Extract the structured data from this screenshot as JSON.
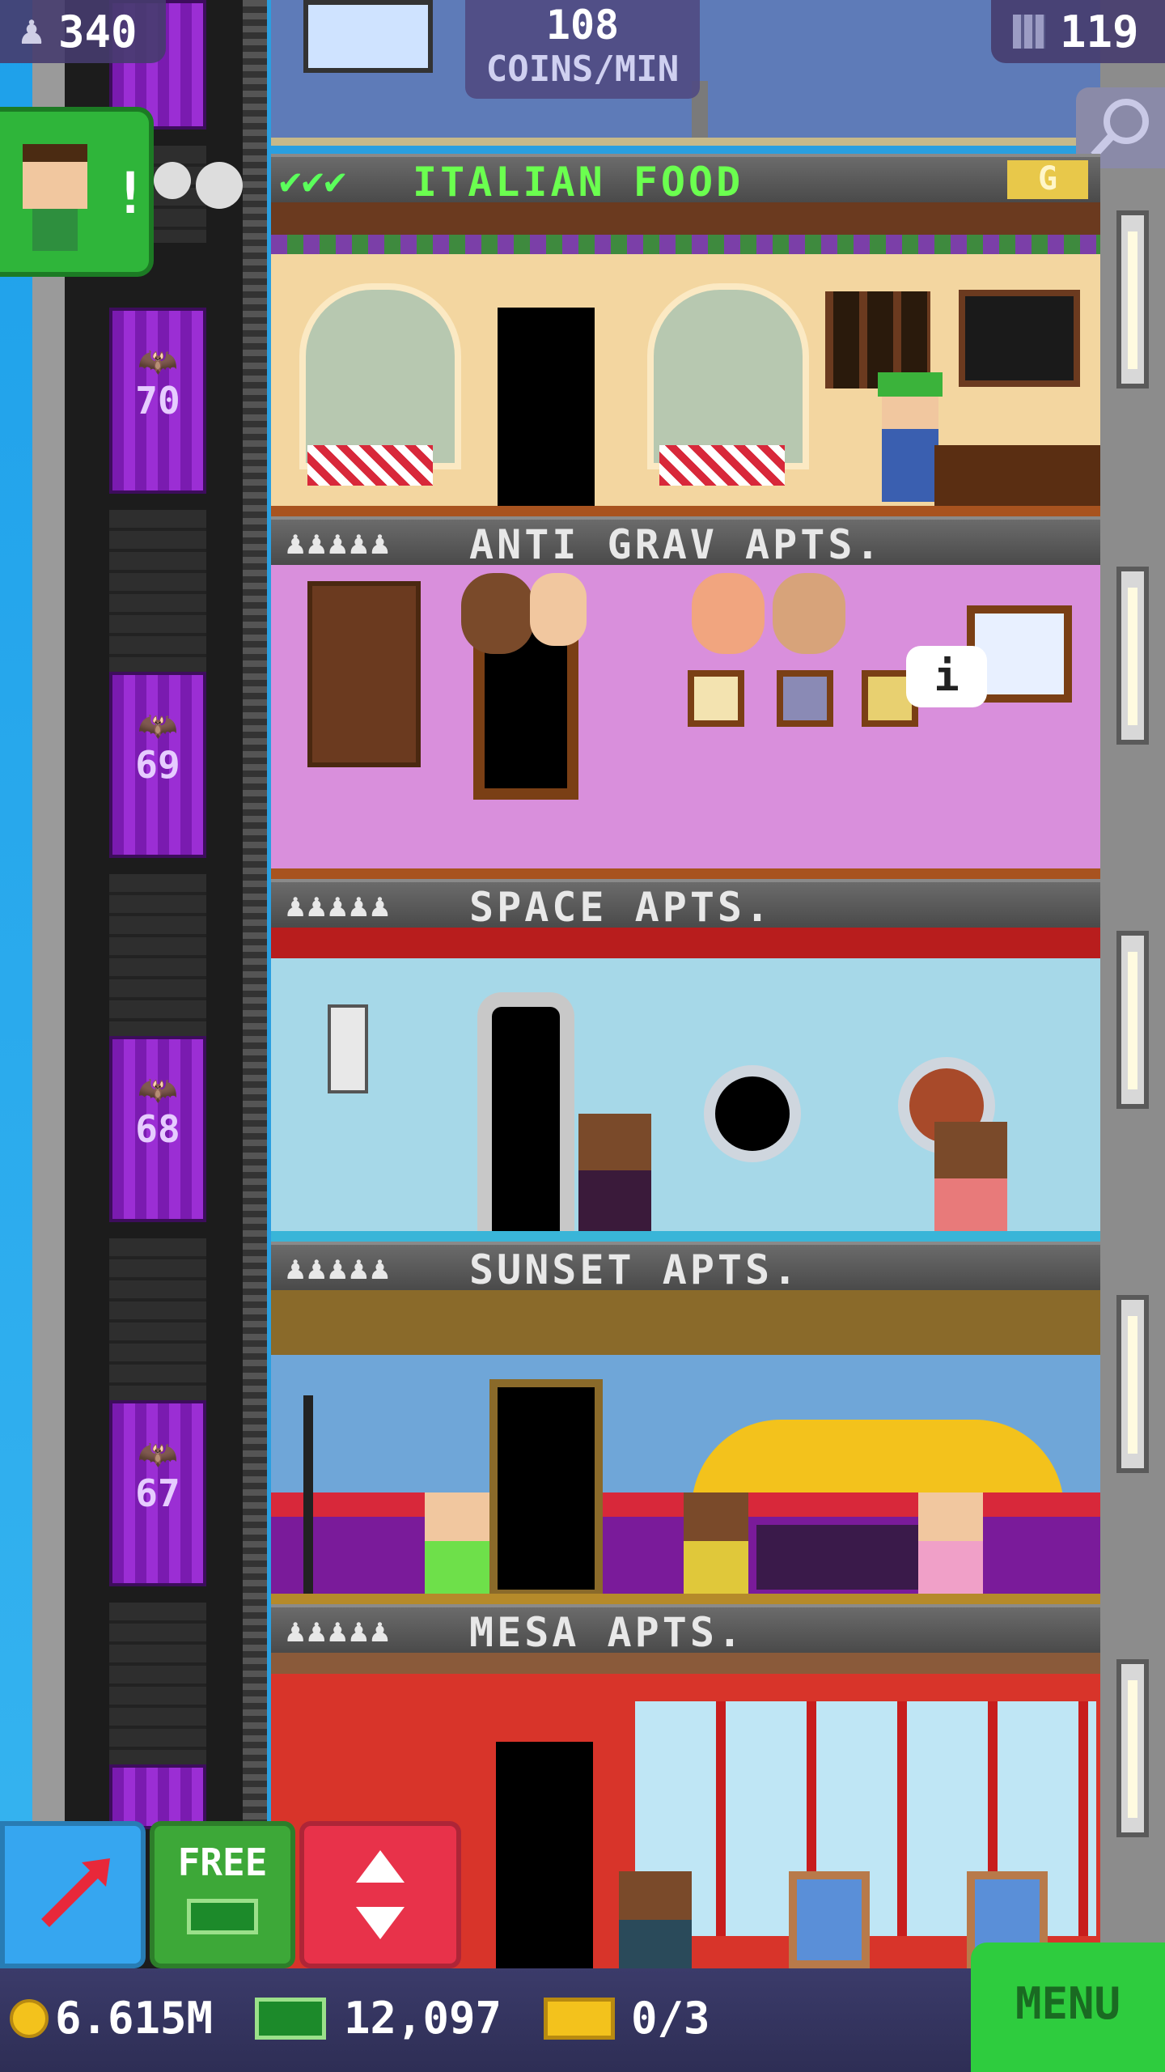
{
  "top_bar": {
    "population": "340",
    "coins_per_min_value": "108",
    "coins_per_min_label": "COINS/MIN",
    "floors_count": "119"
  },
  "notification": {
    "alert": "!"
  },
  "shop_floor": {
    "name": "ITALIAN FOOD",
    "stock_checks": "✔✔✔",
    "badge": "G"
  },
  "floors": [
    {
      "name": "ANTI GRAV APTS.",
      "residents": "♟♟♟♟♟",
      "info": "i"
    },
    {
      "name": "SPACE APTS.",
      "residents": "♟♟♟♟♟"
    },
    {
      "name": "SUNSET APTS.",
      "residents": "♟♟♟♟♟"
    },
    {
      "name": "MESA APTS.",
      "residents": "♟♟♟♟♟"
    }
  ],
  "elevator": {
    "floor_numbers": [
      "70",
      "69",
      "68",
      "67"
    ]
  },
  "buttons": {
    "free_label": "FREE"
  },
  "bottom": {
    "coins": "6.615M",
    "bux": "12,097",
    "tickets": "0/3",
    "menu": "MENU"
  },
  "icons": {
    "person": "person-icon",
    "floor": "floor-icon",
    "search": "magnify-icon",
    "coin": "coin-icon",
    "bux": "bux-icon",
    "ticket": "ticket-icon",
    "arrow": "arrow-icon",
    "elevator": "elevator-icon",
    "bat": "bat-icon"
  },
  "colors": {
    "sky": "#2a9fe0",
    "elevator": "#8a24c2",
    "menu": "#2ecc3e",
    "label_bar": "#5a5a5a"
  }
}
